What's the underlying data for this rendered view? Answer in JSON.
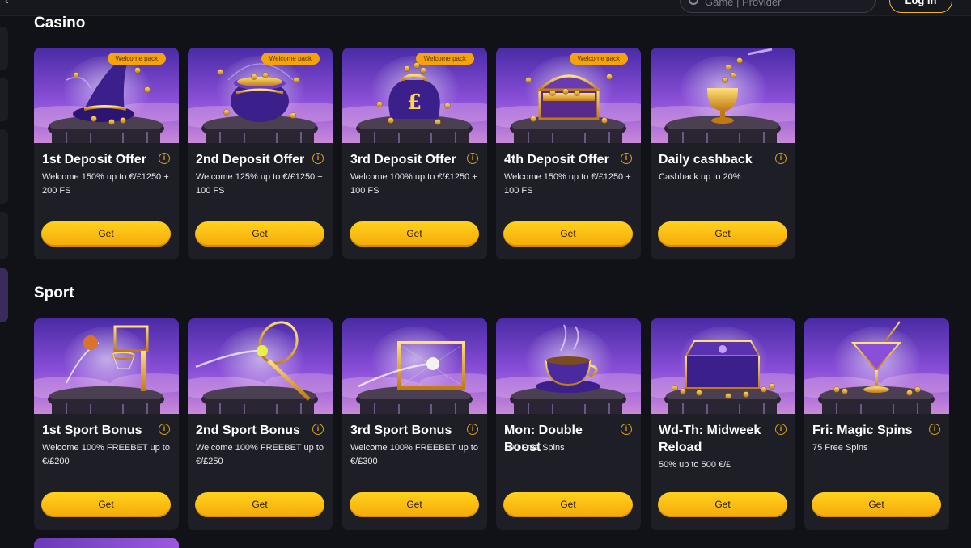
{
  "header": {
    "search_placeholder": "Game | Provider",
    "login_label": "Log in"
  },
  "sections": [
    {
      "title": "Casino",
      "cards": [
        {
          "title": "1st Deposit Offer",
          "desc": "Welcome 150% up to €/£1250 + 200 FS",
          "badge": "Welcome pack",
          "button": "Get",
          "art": "wizard-hat"
        },
        {
          "title": "2nd Deposit Offer",
          "desc": "Welcome 125% up to €/£1250 + 100 FS",
          "badge": "Welcome pack",
          "button": "Get",
          "art": "gold-cauldron"
        },
        {
          "title": "3rd Deposit Offer",
          "desc": "Welcome 100% up to €/£1250 + 100 FS",
          "badge": "Welcome pack",
          "button": "Get",
          "art": "money-bag"
        },
        {
          "title": "4th Deposit Offer",
          "desc": "Welcome 150% up to €/£1250 + 100 FS",
          "badge": "Welcome pack",
          "button": "Get",
          "art": "treasure-chest"
        },
        {
          "title": "Daily cashback",
          "desc": "Cashback up to 20%",
          "badge": "",
          "button": "Get",
          "art": "golden-goblet"
        }
      ]
    },
    {
      "title": "Sport",
      "cards": [
        {
          "title": "1st Sport Bonus",
          "desc": "Welcome 100% FREEBET up to €/£200",
          "badge": "",
          "button": "Get",
          "art": "basketball-hoop"
        },
        {
          "title": "2nd Sport Bonus",
          "desc": "Welcome 100% FREEBET up to €/£250",
          "badge": "",
          "button": "Get",
          "art": "tennis-racket"
        },
        {
          "title": "3rd Sport Bonus",
          "desc": "Welcome 100% FREEBET up to €/£300",
          "badge": "",
          "button": "Get",
          "art": "football-goal"
        },
        {
          "title": "Mon: Double Boost",
          "desc": "100 Free Spins",
          "badge": "",
          "button": "Get",
          "art": "tea-cup"
        },
        {
          "title": "Wd-Th: Midweek Reload",
          "desc": "50% up to 500 €/£",
          "badge": "",
          "button": "Get",
          "art": "jewel-box"
        },
        {
          "title": "Fri: Magic Spins",
          "desc": "75 Free Spins",
          "badge": "",
          "button": "Get",
          "art": "cocktail-glass"
        }
      ]
    }
  ],
  "colors": {
    "background": "#111217",
    "card": "#1d1e26",
    "accent": "#f5b80b",
    "badge": "#f5a30b"
  }
}
